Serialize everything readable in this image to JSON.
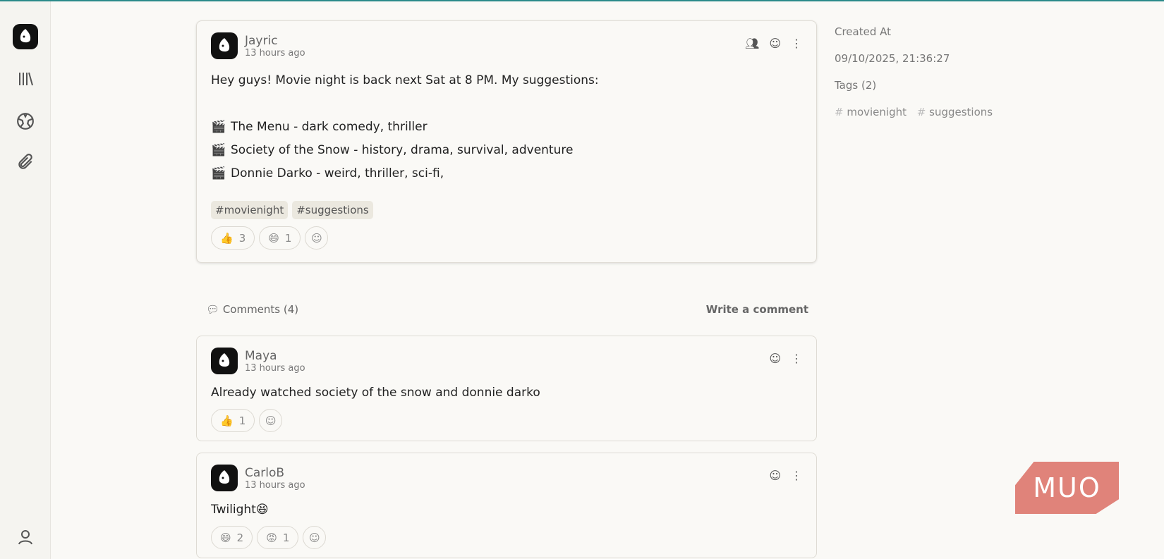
{
  "post": {
    "author": "Jayric",
    "time": "13 hours ago",
    "intro": "Hey guys! Movie night is back next Sat at 8 PM. My suggestions:",
    "items": [
      "The Menu - dark comedy, thriller",
      "Society of the Snow - history, drama, survival, adventure",
      "Donnie Darko - weird, thriller, sci-fi,"
    ],
    "tags": [
      "#movienight",
      "#suggestions"
    ],
    "reactions": [
      {
        "emoji": "👍",
        "count": "3"
      },
      {
        "emoji": "😄",
        "count": "1"
      }
    ]
  },
  "comments_header": {
    "label": "Comments (4)",
    "write": "Write a comment"
  },
  "comments": [
    {
      "author": "Maya",
      "time": "13 hours ago",
      "text": "Already watched society of the snow and donnie darko",
      "reactions": [
        {
          "emoji": "👍",
          "count": "1"
        }
      ]
    },
    {
      "author": "CarloB",
      "time": "13 hours ago",
      "text": "Twilight😆",
      "reactions": [
        {
          "emoji": "😄",
          "count": "2"
        },
        {
          "emoji": "😡",
          "count": "1"
        }
      ]
    }
  ],
  "meta": {
    "created_label": "Created At",
    "created_value": "09/10/2025, 21:36:27",
    "tags_label": "Tags (2)",
    "tags": [
      "movienight",
      "suggestions"
    ]
  },
  "watermark": "MUO"
}
